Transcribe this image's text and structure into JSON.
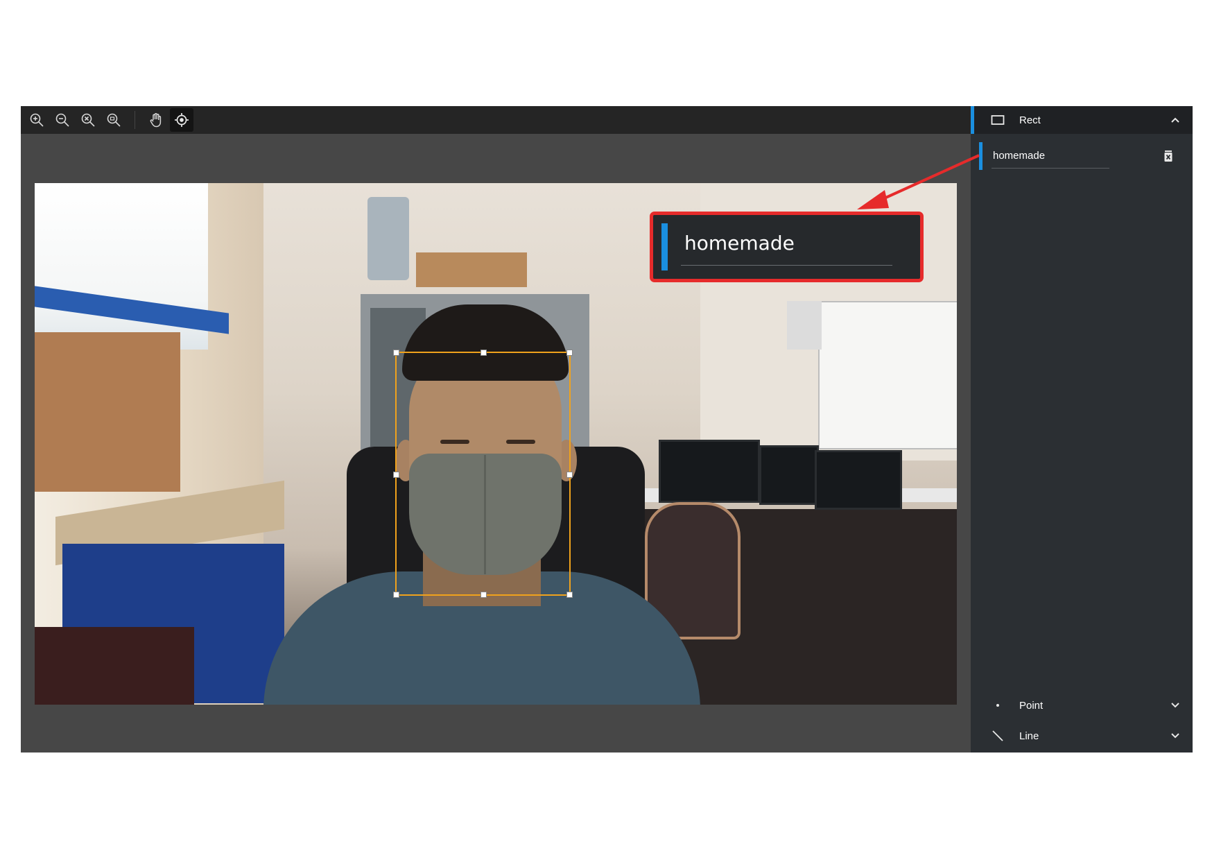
{
  "toolbar": {
    "buttons": [
      "zoom-in",
      "zoom-out",
      "zoom-fit",
      "zoom-reset",
      "pan",
      "crosshair"
    ]
  },
  "annotation": {
    "label": "homemade",
    "box_color": "#f0a21c"
  },
  "callout": {
    "text": "homemade",
    "border_color": "#e62b2b",
    "accent_color": "#1a8fe0"
  },
  "sidebar": {
    "sections": [
      {
        "name": "Rect",
        "icon": "rectangle-icon",
        "expanded": true
      },
      {
        "name": "Point",
        "icon": "point-icon",
        "expanded": false
      },
      {
        "name": "Line",
        "icon": "line-icon",
        "expanded": false
      }
    ],
    "labels": [
      {
        "name": "homemade"
      }
    ]
  },
  "colors": {
    "accent": "#1a8fe0",
    "panel_bg": "#2b2f33",
    "toolbar_bg": "#252525",
    "canvas_bg": "#474747"
  }
}
